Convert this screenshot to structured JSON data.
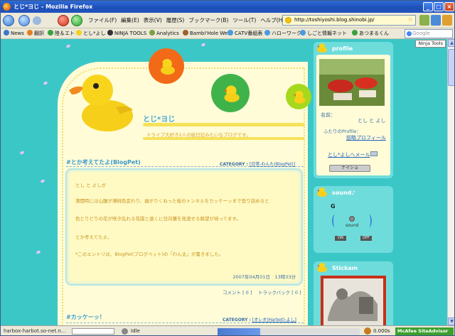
{
  "window": {
    "title": "とじ*ヨじ - Mozilla Firefox",
    "controls": [
      "_",
      "□",
      "×"
    ]
  },
  "menu": [
    "ファイル(F)",
    "編集(E)",
    "表示(V)",
    "履歴(S)",
    "ブックマーク(B)",
    "ツール(T)",
    "ヘルプ(H)"
  ],
  "address": {
    "url": "http://toshiyoshi.blog.shinobi.jp/"
  },
  "bookmarks": [
    "News",
    "翻訳",
    "陸＆エト",
    "とし*よし",
    "NINJA TOOLS",
    "Analytics",
    "Bambi'Hole Web",
    "CATV番組表",
    "ハローワーク",
    "しごと情報ネット",
    "あつまるくん"
  ],
  "search": {
    "placeholder": "Google"
  },
  "page": {
    "ninja_badge": "Ninja Tools",
    "blog_title": "とじ*ヨじ",
    "blog_desc": "ドライブ大好き2人の絵日記みたいなブログです。",
    "post1": {
      "title": "#とか考えてたよ(BlogPet)",
      "category_label": "CATEGORY :",
      "category": "[日常-わんた(BlogPet)]",
      "author": "とし と よしが",
      "line1": "満開時には山腹が薄桃色変わり、曲がりくねった桜のトンネルをカッケーッまで登り詰めると",
      "line2": "色とりどりの花が咲き乱れる花園と遠くに日向灘を見渡せる眺望が待ってます。",
      "line3": "とか考えてたよ。",
      "line4": "*このエントリは、BlogPet(ブログペット)の「わん太」が書きました。",
      "date": "2007年04月01日　13時33分",
      "comment": "コメント [ 0 ]",
      "trackback": "トラックバック [ 0 ]"
    },
    "post2": {
      "title": "#カッケーッ！",
      "category_label": "CATEGORY :",
      "category": "[オレオ(Harbot)-よし]"
    }
  },
  "sidebar": {
    "profile": {
      "header": "profile",
      "name_label": "名前：",
      "name_value": "とし と よし",
      "profile_label": "ふたりのProfile：",
      "profile_link": "前略プロフィール",
      "mail_link": "とし*よしへメール",
      "nice_button": "ナイショ"
    },
    "sound": {
      "header": "sound♪",
      "letter": "G",
      "label": "sound",
      "on": "ON",
      "off": "OFF"
    },
    "stickam": {
      "header": "Stickam"
    }
  },
  "status": {
    "left": "harbox-harbot.so-net.n...",
    "idle": "Idle",
    "time": "0.000s",
    "mcafee": "McAfee SiteAdvisor"
  },
  "colors": {
    "bg": "#3cc7c7",
    "cream": "#fffcd7",
    "accent": "#f6e25a",
    "link": "#3a9ad0"
  }
}
